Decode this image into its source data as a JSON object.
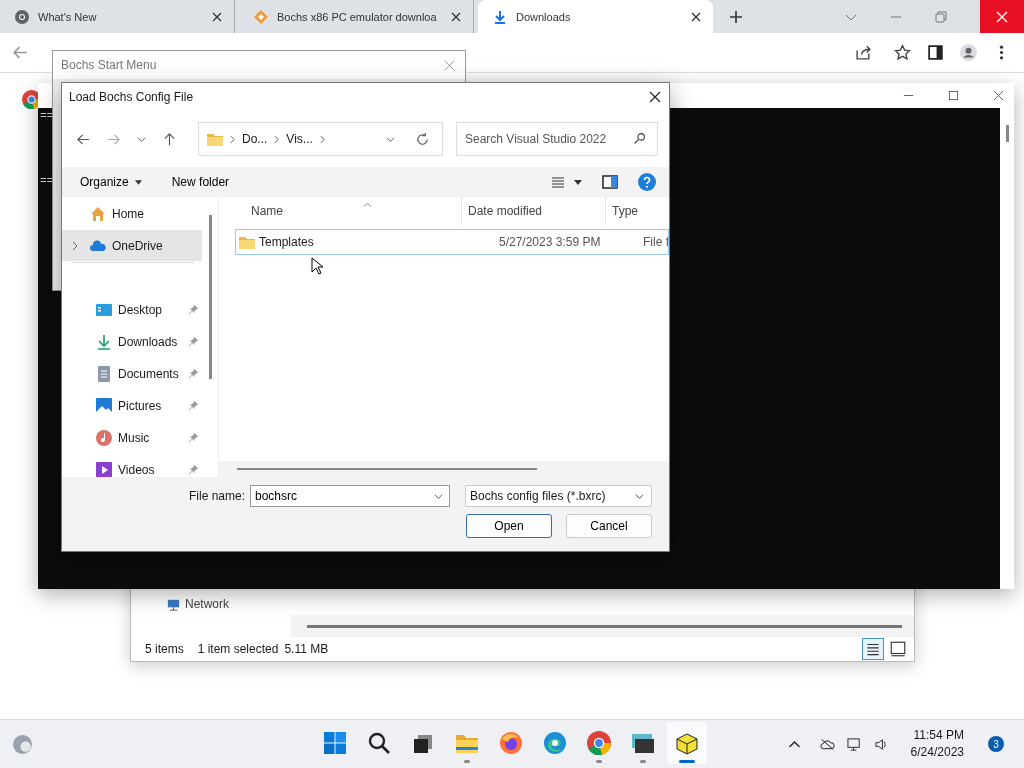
{
  "browser": {
    "tabs": [
      {
        "title": "What's New",
        "kind": "chrome",
        "selected": false
      },
      {
        "title": "Bochs x86 PC emulator downloa",
        "kind": "diamond",
        "selected": false
      },
      {
        "title": "Downloads",
        "kind": "download",
        "selected": true
      }
    ]
  },
  "explorer": {
    "network": "Network",
    "status": [
      "5 items",
      "1 item selected",
      "5.11 MB"
    ]
  },
  "console": {
    "lines": [
      "==",
      "=="
    ]
  },
  "start_menu": {
    "title": "Bochs Start Menu"
  },
  "dialog": {
    "title": "Load Bochs Config File",
    "breadcrumb": [
      "Do...",
      "Vis..."
    ],
    "search": {
      "placeholder": "Search Visual Studio 2022"
    },
    "commands": [
      "Organize",
      "New folder"
    ],
    "nav_top": [
      {
        "label": "Home",
        "kind": "home",
        "selected": false
      },
      {
        "label": "OneDrive",
        "kind": "cloud",
        "selected": true
      }
    ],
    "quick_access": [
      {
        "label": "Desktop",
        "kind": "desktop",
        "selected": false
      },
      {
        "label": "Downloads",
        "kind": "download",
        "selected": false
      },
      {
        "label": "Documents",
        "kind": "document",
        "selected": false
      },
      {
        "label": "Pictures",
        "kind": "picture",
        "selected": false
      },
      {
        "label": "Music",
        "kind": "music",
        "selected": false
      },
      {
        "label": "Videos",
        "kind": "video",
        "selected": false
      }
    ],
    "columns": [
      "Name",
      "Date modified",
      "Type"
    ],
    "rows": [
      {
        "name": "Templates",
        "date": "5/27/2023 3:59 PM",
        "type": "File f",
        "selected": true
      }
    ],
    "file_name": {
      "label": "File name:",
      "value": "bochsrc"
    },
    "filter": "Bochs config files (*.bxrc)",
    "buttons": [
      {
        "label": "Open",
        "kind": "primary"
      },
      {
        "label": "Cancel",
        "kind": "normal"
      }
    ]
  },
  "taskbar": {
    "apps": [
      {
        "kind": "start",
        "running": false,
        "selected": false
      },
      {
        "kind": "search",
        "running": false,
        "selected": false
      },
      {
        "kind": "taskview",
        "running": false,
        "selected": false
      },
      {
        "kind": "folder",
        "running": true,
        "selected": false
      },
      {
        "kind": "firefox",
        "running": false,
        "selected": false
      },
      {
        "kind": "edge",
        "running": false,
        "selected": false
      },
      {
        "kind": "chrome",
        "running": true,
        "selected": false
      },
      {
        "kind": "terminal",
        "running": true,
        "selected": false
      },
      {
        "kind": "box",
        "running": true,
        "selected": true
      }
    ],
    "time": "11:54 PM",
    "date": "6/24/2023",
    "badge": "3"
  }
}
